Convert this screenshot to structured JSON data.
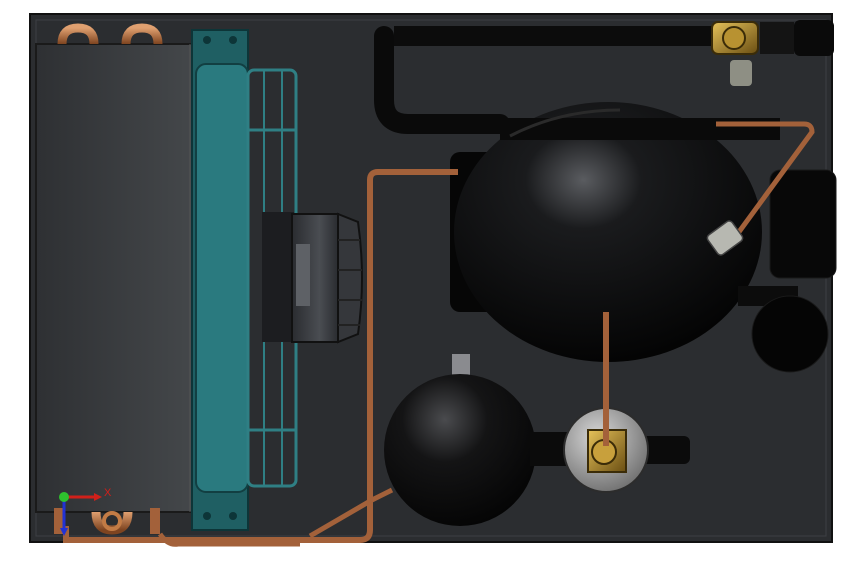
{
  "colors": {
    "background": "#ffffff",
    "base_plate": "#2b2d30",
    "condenser_body": "#3a3c3f",
    "fan_guard": "#1f5f63",
    "copper": "#b06a3c",
    "compressor": "#050505",
    "receiver": "#0a0a0a",
    "brass": "#9c7a2c",
    "motor": "#3b3d42",
    "axis_x": "#d0201a",
    "axis_y": "#2ec12e",
    "axis_z": "#2232d4"
  },
  "triad": {
    "x_label": "X"
  },
  "components": [
    {
      "name": "condenser-coil",
      "icon": "condenser-coil-icon"
    },
    {
      "name": "condenser-fan",
      "icon": "fan-guard-icon"
    },
    {
      "name": "fan-motor",
      "icon": "motor-icon"
    },
    {
      "name": "compressor",
      "icon": "compressor-icon"
    },
    {
      "name": "liquid-receiver",
      "icon": "receiver-icon"
    },
    {
      "name": "service-valve",
      "icon": "valve-icon"
    },
    {
      "name": "suction-line",
      "icon": "pipe-icon"
    },
    {
      "name": "discharge-line",
      "icon": "pipe-icon"
    }
  ]
}
